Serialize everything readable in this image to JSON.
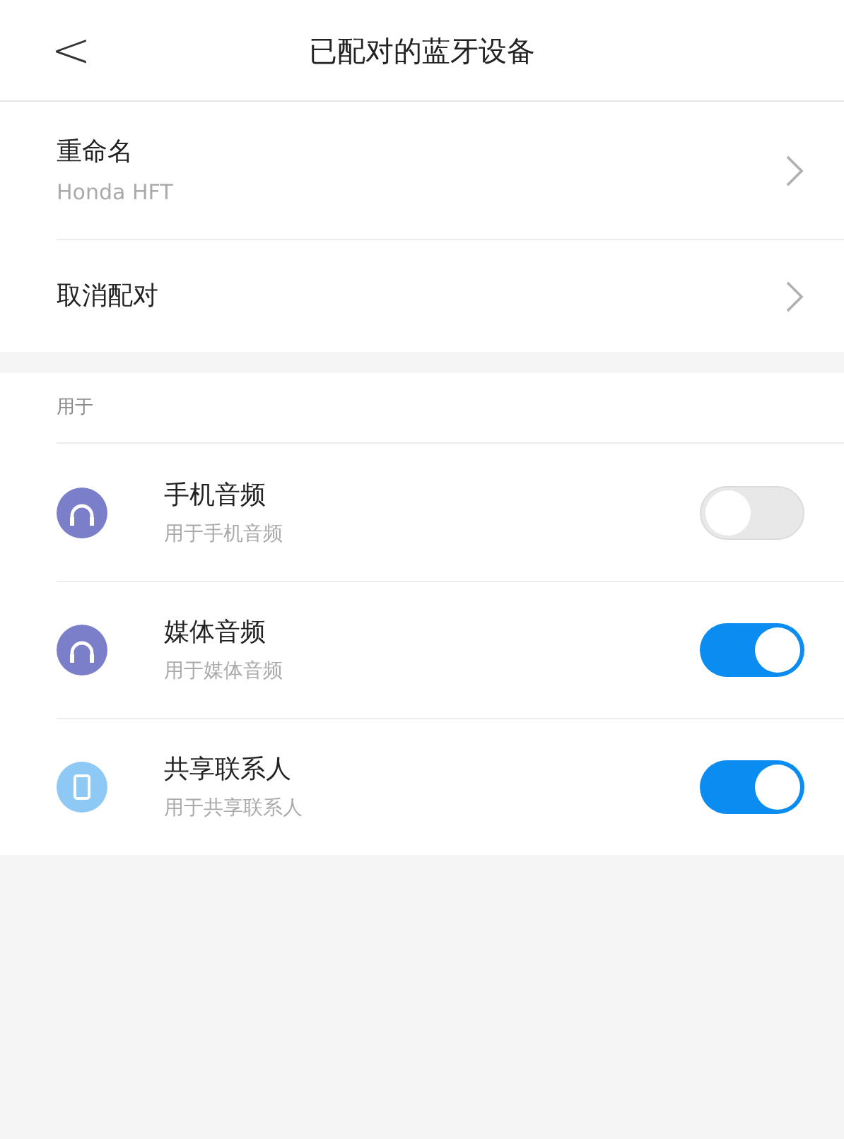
{
  "header": {
    "back": "<",
    "title": "已配对的蓝牙设备"
  },
  "menu": [
    {
      "label": "重命名",
      "value": "Honda HFT"
    },
    {
      "label": "取消配对"
    }
  ],
  "section": {
    "label": "用于",
    "items": [
      {
        "kind": "headset",
        "color": "#7b7fc9",
        "title": "手机音频",
        "subtitle": "用于手机音频",
        "on": false
      },
      {
        "kind": "headset",
        "color": "#7b7fc9",
        "title": "媒体音频",
        "subtitle": "用于媒体音频",
        "on": true
      },
      {
        "kind": "phone",
        "color": "#8ec8f5",
        "title": "共享联系人",
        "subtitle": "用于共享联系人",
        "on": true
      }
    ]
  }
}
